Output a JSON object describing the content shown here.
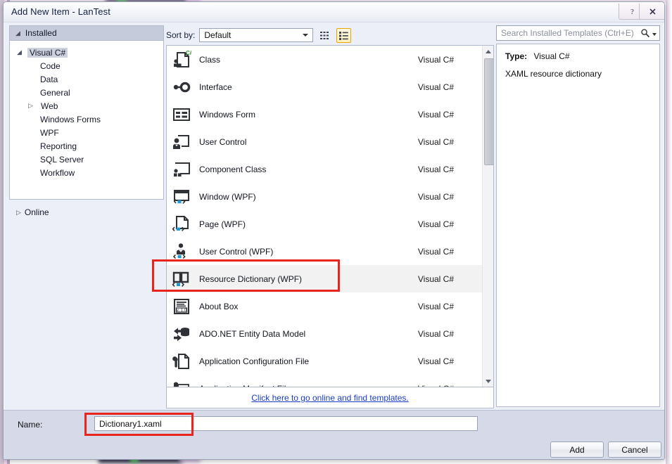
{
  "window": {
    "title": "Add New Item - LanTest",
    "help_button": "?",
    "close_button": "✕"
  },
  "sidebar": {
    "header": "Installed",
    "header_arrow": "◢",
    "items": [
      {
        "label": "Visual C#",
        "level": 1,
        "arrow": "◢",
        "selected": true
      },
      {
        "label": "Code",
        "level": 2,
        "arrow": "",
        "selected": false
      },
      {
        "label": "Data",
        "level": 2,
        "arrow": "",
        "selected": false
      },
      {
        "label": "General",
        "level": 2,
        "arrow": "",
        "selected": false
      },
      {
        "label": "Web",
        "level": 2,
        "arrow": "▷",
        "selected": false
      },
      {
        "label": "Windows Forms",
        "level": 2,
        "arrow": "",
        "selected": false
      },
      {
        "label": "WPF",
        "level": 2,
        "arrow": "",
        "selected": false
      },
      {
        "label": "Reporting",
        "level": 2,
        "arrow": "",
        "selected": false
      },
      {
        "label": "SQL Server",
        "level": 2,
        "arrow": "",
        "selected": false
      },
      {
        "label": "Workflow",
        "level": 2,
        "arrow": "",
        "selected": false
      }
    ],
    "online": {
      "label": "Online",
      "arrow": "▷"
    }
  },
  "toolbar": {
    "sort_by_label": "Sort by:",
    "sort_by_value": "Default",
    "view_tiles_icon": "tiles-view-icon",
    "view_list_icon": "list-view-icon",
    "view_selected": "list"
  },
  "templates": {
    "items": [
      {
        "name": "Class",
        "language": "Visual C#",
        "icon": "class-icon",
        "selected": false
      },
      {
        "name": "Interface",
        "language": "Visual C#",
        "icon": "interface-icon",
        "selected": false
      },
      {
        "name": "Windows Form",
        "language": "Visual C#",
        "icon": "windows-form-icon",
        "selected": false
      },
      {
        "name": "User Control",
        "language": "Visual C#",
        "icon": "user-control-icon",
        "selected": false
      },
      {
        "name": "Component Class",
        "language": "Visual C#",
        "icon": "component-class-icon",
        "selected": false
      },
      {
        "name": "Window (WPF)",
        "language": "Visual C#",
        "icon": "window-wpf-icon",
        "selected": false
      },
      {
        "name": "Page (WPF)",
        "language": "Visual C#",
        "icon": "page-wpf-icon",
        "selected": false
      },
      {
        "name": "User Control (WPF)",
        "language": "Visual C#",
        "icon": "user-control-wpf-icon",
        "selected": false
      },
      {
        "name": "Resource Dictionary (WPF)",
        "language": "Visual C#",
        "icon": "resource-dictionary-icon",
        "selected": true
      },
      {
        "name": "About Box",
        "language": "Visual C#",
        "icon": "about-box-icon",
        "selected": false
      },
      {
        "name": "ADO.NET Entity Data Model",
        "language": "Visual C#",
        "icon": "ado-net-entity-icon",
        "selected": false
      },
      {
        "name": "Application Configuration File",
        "language": "Visual C#",
        "icon": "app-config-icon",
        "selected": false
      },
      {
        "name": "Application Manifest File",
        "language": "Visual C#",
        "icon": "app-manifest-icon",
        "selected": false
      }
    ],
    "online_link": "Click here to go online and find templates."
  },
  "search": {
    "placeholder": "Search Installed Templates (Ctrl+E)",
    "icon": "search-icon"
  },
  "details": {
    "type_label": "Type:",
    "type_value": "Visual C#",
    "description": "XAML resource dictionary"
  },
  "footer": {
    "name_label": "Name:",
    "name_value": "Dictionary1.xaml",
    "add_button": "Add",
    "cancel_button": "Cancel"
  },
  "annotations": {
    "accent_color": "#e8241f",
    "highlight_row": "Resource Dictionary (WPF)",
    "highlight_field": "Dictionary1.xaml"
  }
}
